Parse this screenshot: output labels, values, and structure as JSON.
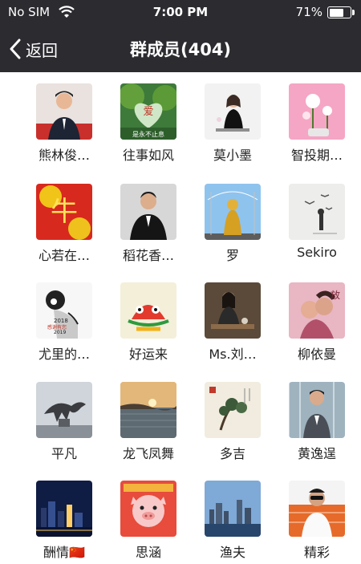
{
  "status_bar": {
    "carrier": "No SIM",
    "time": "7:00 PM",
    "battery": "71%",
    "battery_level": 0.71
  },
  "nav": {
    "back_label": "返回",
    "title": "群成员(404)"
  },
  "members": [
    {
      "name": "熊林俊…",
      "icon": "avatar-man-suit"
    },
    {
      "name": "往事如风",
      "icon": "avatar-heart-tree"
    },
    {
      "name": "莫小墨",
      "icon": "avatar-woman-bench"
    },
    {
      "name": "智投期…",
      "icon": "avatar-pink-flowers"
    },
    {
      "name": "心若在…",
      "icon": "avatar-red-calligraphy"
    },
    {
      "name": "稻花香…",
      "icon": "avatar-man-suit-gray"
    },
    {
      "name": "罗",
      "icon": "avatar-golden-buddha"
    },
    {
      "name": "Sekiro",
      "icon": "avatar-birds-sketch"
    },
    {
      "name": "尤里的…",
      "icon": "avatar-cartoon-bow"
    },
    {
      "name": "好运来",
      "icon": "avatar-lion-dance"
    },
    {
      "name": "Ms.刘…",
      "icon": "avatar-woman-tea"
    },
    {
      "name": "柳依曼",
      "icon": "avatar-couple-pink"
    },
    {
      "name": "平凡",
      "icon": "avatar-horse-statue"
    },
    {
      "name": "龙飞凤舞",
      "icon": "avatar-sea-sunset"
    },
    {
      "name": "多吉",
      "icon": "avatar-pine-painting"
    },
    {
      "name": "黄逸逞",
      "icon": "avatar-man-glass-wall"
    },
    {
      "name": "酬情🇨🇳",
      "icon": "avatar-city-night"
    },
    {
      "name": "思涵",
      "icon": "avatar-pig-cartoon"
    },
    {
      "name": "渔夫",
      "icon": "avatar-city-bay"
    },
    {
      "name": "精彩",
      "icon": "avatar-man-sunglasses"
    }
  ]
}
